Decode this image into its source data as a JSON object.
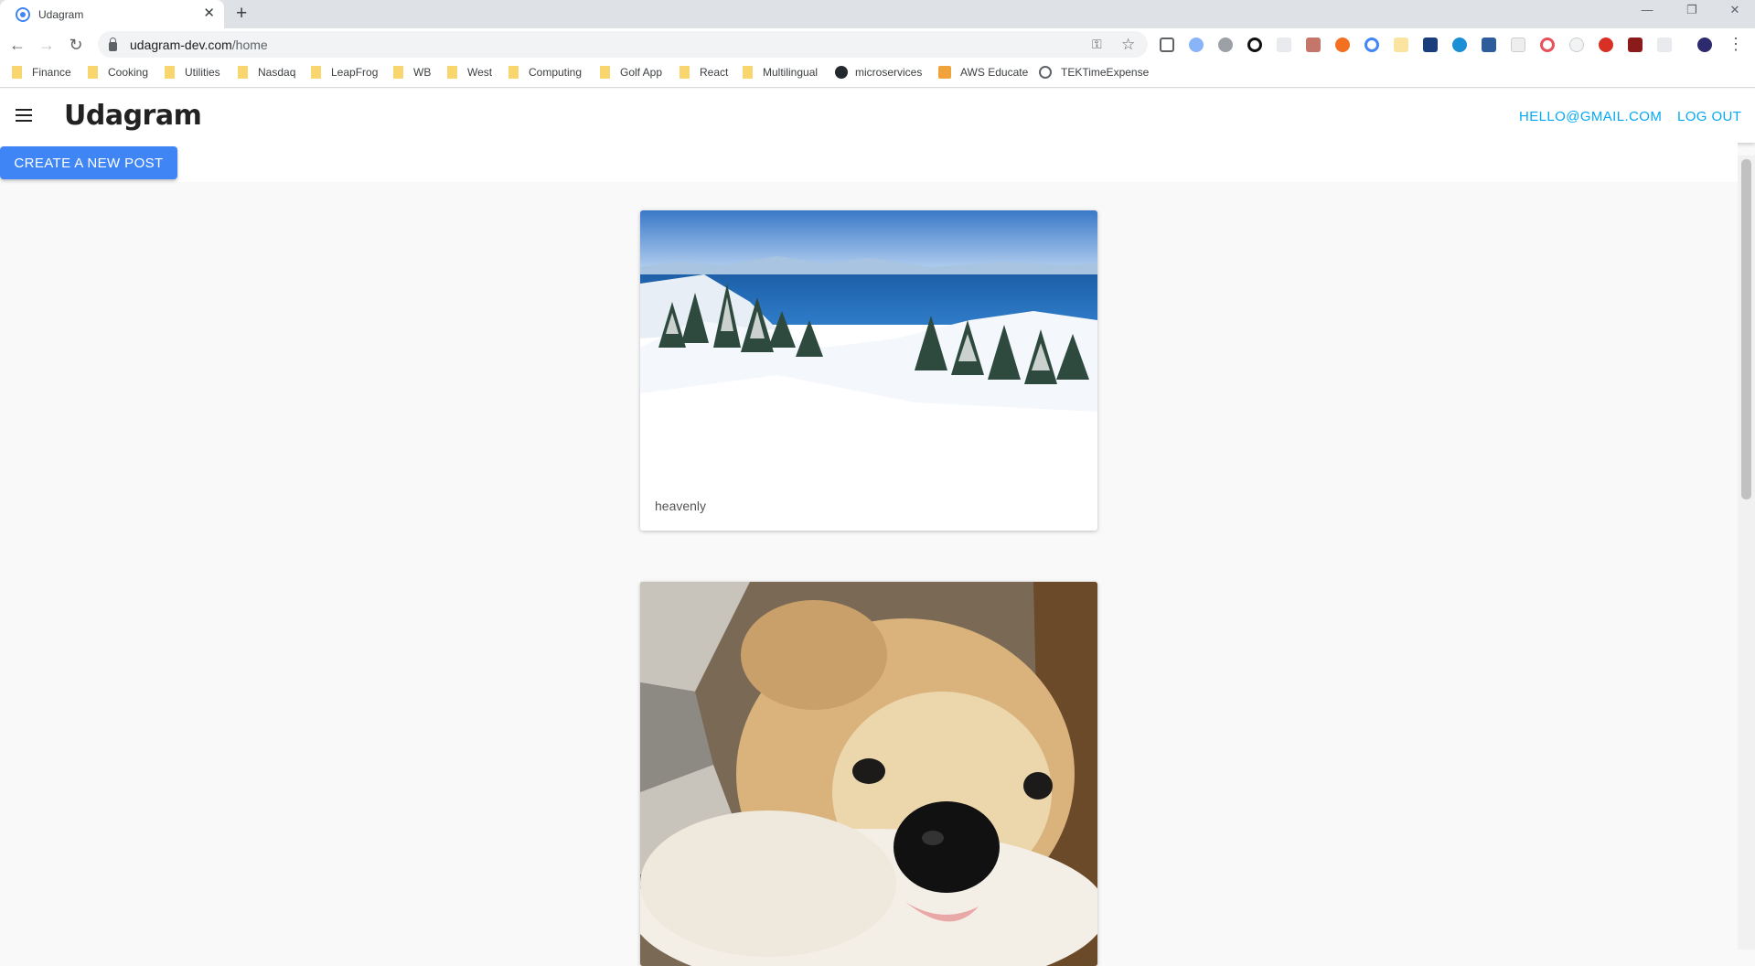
{
  "browser": {
    "tab_title": "Udagram",
    "new_tab": "+",
    "close_tab": "✕",
    "url_host": "udagram-dev.com",
    "url_path": "/home",
    "back": "←",
    "forward": "→",
    "reload": "↻",
    "key": "⚿",
    "star": "☆",
    "menu": "⋮",
    "minimize": "—",
    "maximize": "❐",
    "close_window": "✕"
  },
  "bookmarks": [
    {
      "label": "Finance",
      "icon": "folder-icon"
    },
    {
      "label": "Cooking",
      "icon": "folder-icon"
    },
    {
      "label": "Utilities",
      "icon": "folder-icon"
    },
    {
      "label": "Nasdaq",
      "icon": "folder-icon"
    },
    {
      "label": "LeapFrog",
      "icon": "folder-icon"
    },
    {
      "label": "WB",
      "icon": "folder-icon"
    },
    {
      "label": "West",
      "icon": "folder-icon"
    },
    {
      "label": "Computing",
      "icon": "folder-icon"
    },
    {
      "label": "Golf App",
      "icon": "folder-icon"
    },
    {
      "label": "React",
      "icon": "folder-icon"
    },
    {
      "label": "Multilingual",
      "icon": "folder-icon"
    },
    {
      "label": "microservices",
      "icon": "github-icon"
    },
    {
      "label": "AWS Educate",
      "icon": "aws-cube-icon"
    },
    {
      "label": "TEKTimeExpense",
      "icon": "globe-icon"
    }
  ],
  "app": {
    "brand": "Udagram",
    "user_email": "HELLO@GMAIL.COM",
    "logout": "LOG OUT",
    "create_post": "CREATE A NEW POST",
    "accent_color": "#03a9f4",
    "button_color": "#3f85f5"
  },
  "posts": [
    {
      "caption": "heavenly",
      "image": "snowy mountain lake view"
    },
    {
      "caption": "",
      "image": "golden retriever puppy close-up"
    }
  ]
}
